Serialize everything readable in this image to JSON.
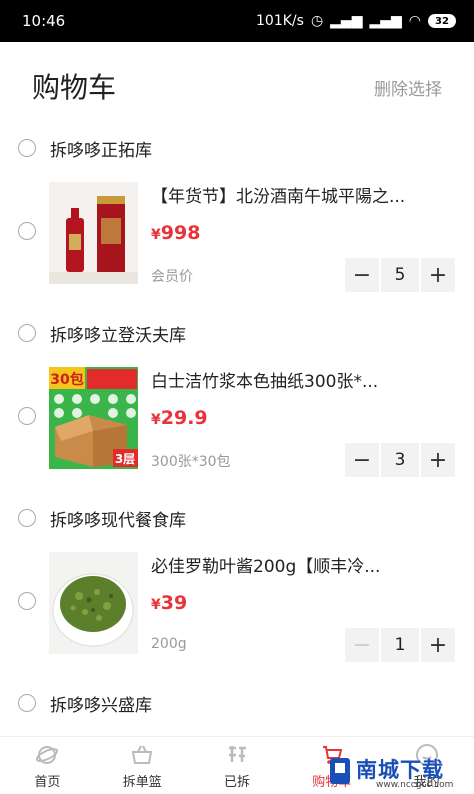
{
  "statusbar": {
    "time": "10:46",
    "speed": "101K/s",
    "battery": "32"
  },
  "header": {
    "title": "购物车",
    "delete_label": "删除选择"
  },
  "stores": [
    {
      "name": "拆哆哆正拓库"
    },
    {
      "name": "拆哆哆立登沃夫库"
    },
    {
      "name": "拆哆哆现代餐食库"
    },
    {
      "name": "拆哆哆兴盛库"
    }
  ],
  "items": [
    {
      "title": "【年货节】北汾酒南午城平陽之...",
      "currency": "¥",
      "price": "998",
      "spec": "会员价",
      "qty": "5"
    },
    {
      "title": "白士洁竹浆本色抽纸300张*...",
      "currency": "¥",
      "price": "29.9",
      "spec": "300张*30包",
      "qty": "3",
      "thumb_text": "30包",
      "thumb_badge": "3层"
    },
    {
      "title": "必佳罗勒叶酱200g【顺丰冷...",
      "currency": "¥",
      "price": "39",
      "spec": "200g",
      "qty": "1"
    }
  ],
  "nav": [
    {
      "label": "首页",
      "icon": "planet-icon"
    },
    {
      "label": "拆单篮",
      "icon": "basket-icon"
    },
    {
      "label": "已拆",
      "icon": "chai-icon"
    },
    {
      "label": "购物车",
      "icon": "cart-icon",
      "active": true
    },
    {
      "label": "我的",
      "icon": "profile-icon"
    }
  ],
  "watermark": {
    "text": "南城下载",
    "url": "www.nccgcc.com"
  },
  "colors": {
    "accent": "#e8333a",
    "muted": "#999999"
  }
}
